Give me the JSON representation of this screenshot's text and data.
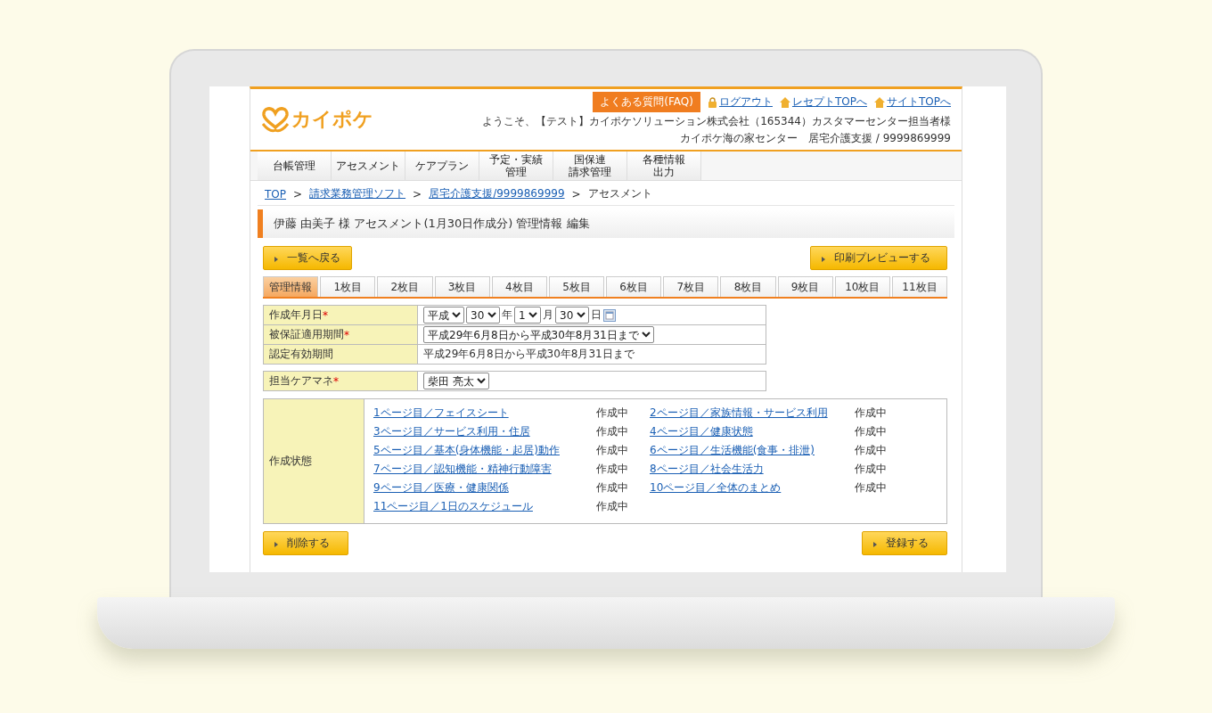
{
  "header": {
    "logo": "カイポケ",
    "faq_button": "よくある質問(FAQ)",
    "links": [
      {
        "kind": "logout",
        "label": "ログアウト"
      },
      {
        "kind": "home",
        "label": "レセプトTOPへ"
      },
      {
        "kind": "home",
        "label": "サイトTOPへ"
      }
    ],
    "welcome": "ようこそ、【テスト】カイポケソリューション株式会社（165344）カスタマーセンター担当者様",
    "office": "カイポケ海の家センター　居宅介護支援 / 9999869999"
  },
  "nav": [
    {
      "lines": [
        "台帳管理"
      ]
    },
    {
      "lines": [
        "アセスメント"
      ]
    },
    {
      "lines": [
        "ケアプラン"
      ]
    },
    {
      "lines": [
        "予定・実績",
        "管理"
      ]
    },
    {
      "lines": [
        "国保連",
        "請求管理"
      ]
    },
    {
      "lines": [
        "各種情報",
        "出力"
      ]
    }
  ],
  "breadcrumb": [
    {
      "kind": "link",
      "label": "TOP"
    },
    {
      "kind": "sep",
      "label": ">"
    },
    {
      "kind": "link",
      "label": "請求業務管理ソフト"
    },
    {
      "kind": "sep",
      "label": ">"
    },
    {
      "kind": "link",
      "label": "居宅介護支援/9999869999"
    },
    {
      "kind": "sep",
      "label": ">"
    },
    {
      "kind": "current",
      "label": "アセスメント"
    }
  ],
  "title": "伊藤 由美子 様 アセスメント(1月30日作成分) 管理情報 編集",
  "top_buttons": {
    "left": "一覧へ戻る",
    "right": "印刷プレビューする"
  },
  "tabs": [
    {
      "label": "管理情報",
      "selected": true
    },
    {
      "label": "1枚目",
      "selected": false
    },
    {
      "label": "2枚目",
      "selected": false
    },
    {
      "label": "3枚目",
      "selected": false
    },
    {
      "label": "4枚目",
      "selected": false
    },
    {
      "label": "5枚目",
      "selected": false
    },
    {
      "label": "6枚目",
      "selected": false
    },
    {
      "label": "7枚目",
      "selected": false
    },
    {
      "label": "8枚目",
      "selected": false
    },
    {
      "label": "9枚目",
      "selected": false
    },
    {
      "label": "10枚目",
      "selected": false
    },
    {
      "label": "11枚目",
      "selected": false
    }
  ],
  "form": [
    {
      "label": "作成年月日",
      "mark": "*",
      "kind": "date",
      "parts": [
        {
          "kind": "select",
          "value": "平成"
        },
        {
          "kind": "select",
          "value": "30"
        },
        {
          "kind": "text",
          "value": "年"
        },
        {
          "kind": "select",
          "value": "1"
        },
        {
          "kind": "text",
          "value": "月"
        },
        {
          "kind": "select",
          "value": "30"
        },
        {
          "kind": "text",
          "value": "日"
        },
        {
          "kind": "calendar"
        }
      ]
    },
    {
      "label": "被保証適用期間",
      "mark": "*",
      "kind": "select",
      "value": "平成29年6月8日から平成30年8月31日まで"
    },
    {
      "label": "認定有効期間",
      "kind": "text",
      "value": "平成29年6月8日から平成30年8月31日まで"
    }
  ],
  "care_manager": {
    "label": "担当ケアマネ",
    "mark": "*",
    "value": "柴田 亮太"
  },
  "status": {
    "label": "作成状態",
    "items": [
      {
        "link": "1ページ目／フェイスシート",
        "state": "作成中"
      },
      {
        "link": "2ページ目／家族情報・サービス利用",
        "state": "作成中"
      },
      {
        "link": "3ページ目／サービス利用・住居",
        "state": "作成中"
      },
      {
        "link": "4ページ目／健康状態",
        "state": "作成中"
      },
      {
        "link": "5ページ目／基本(身体機能・起居)動作",
        "state": "作成中"
      },
      {
        "link": "6ページ目／生活機能(食事・排泄)",
        "state": "作成中"
      },
      {
        "link": "7ページ目／認知機能・精神行動障害",
        "state": "作成中"
      },
      {
        "link": "8ページ目／社会生活力",
        "state": "作成中"
      },
      {
        "link": "9ページ目／医療・健康関係",
        "state": "作成中"
      },
      {
        "link": "10ページ目／全体のまとめ",
        "state": "作成中"
      },
      {
        "link": "11ページ目／1日のスケジュール",
        "state": "作成中"
      }
    ]
  },
  "bottom_buttons": {
    "left": "削除する",
    "right": "登録する"
  }
}
